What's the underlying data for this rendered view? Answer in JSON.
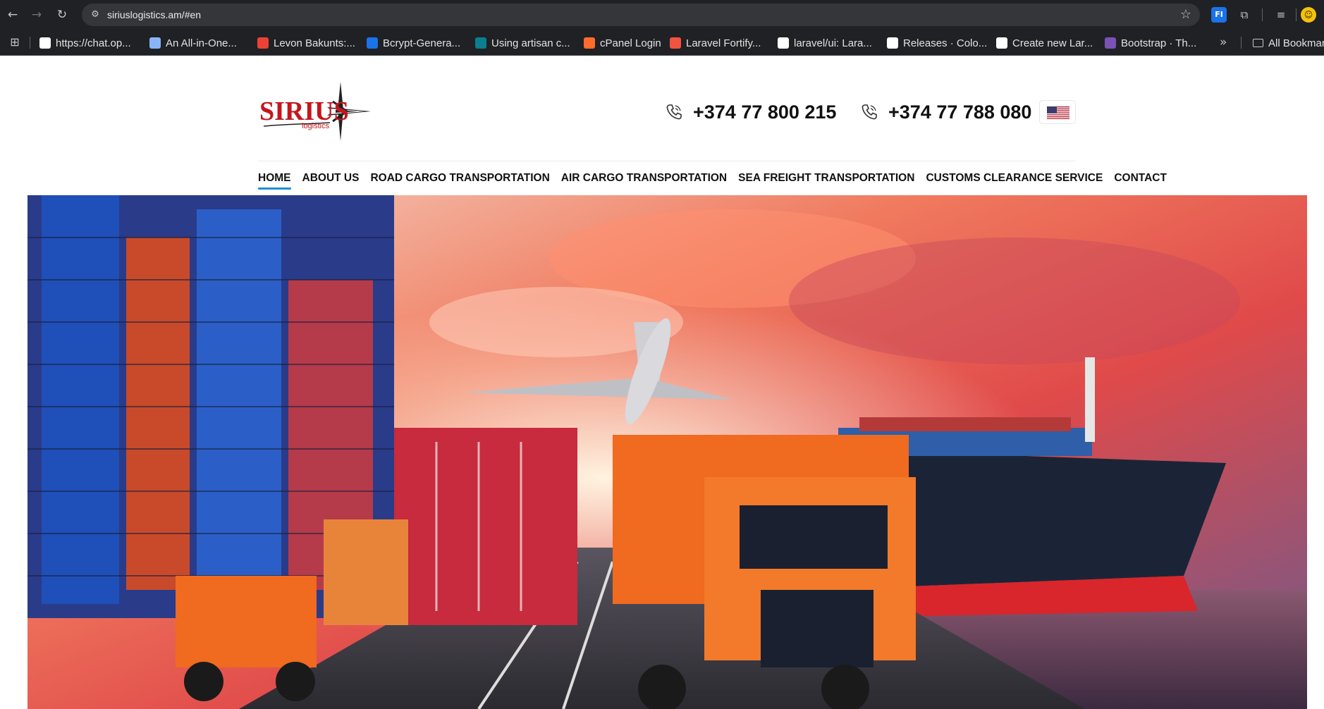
{
  "browser": {
    "url": "siriuslogistics.am/#en",
    "bookmarks": [
      {
        "label": "https://chat.op...",
        "icon": "openai-icon",
        "color": "#ffffff"
      },
      {
        "label": "An All-in-One...",
        "icon": "globe-icon",
        "color": "#8ab4f8"
      },
      {
        "label": "Levon Bakunts:...",
        "icon": "chrome-colorful-icon",
        "color": "#ea4335"
      },
      {
        "label": "Bcrypt-Genera...",
        "icon": "bcrypt-icon",
        "color": "#1a73e8"
      },
      {
        "label": "Using artisan c...",
        "icon": "s-letter-icon",
        "color": "#0a7f8f"
      },
      {
        "label": "cPanel Login",
        "icon": "cpanel-icon",
        "color": "#ff6c2c"
      },
      {
        "label": "Laravel Fortify...",
        "icon": "laravel-icon",
        "color": "#f05340"
      },
      {
        "label": "laravel/ui: Lara...",
        "icon": "github-icon",
        "color": "#ffffff"
      },
      {
        "label": "Releases · Colo...",
        "icon": "github-icon",
        "color": "#ffffff"
      },
      {
        "label": "Create new Lar...",
        "icon": "medium-icon",
        "color": "#ffffff"
      },
      {
        "label": "Bootstrap · Th...",
        "icon": "bootstrap-icon",
        "color": "#7952b3"
      }
    ],
    "all_bookmarks": "All Bookmarks"
  },
  "site": {
    "logo_text": "SIRIUS",
    "logo_sub": "logistics",
    "phones": [
      "+374 77 800 215",
      "+374 77 788 080"
    ],
    "language_flag": "us-flag-icon",
    "nav": [
      {
        "label": "HOME",
        "active": true
      },
      {
        "label": "ABOUT US",
        "active": false
      },
      {
        "label": "ROAD CARGO TRANSPORTATION",
        "active": false
      },
      {
        "label": "AIR CARGO TRANSPORTATION",
        "active": false
      },
      {
        "label": "SEA FREIGHT TRANSPORTATION",
        "active": false
      },
      {
        "label": "CUSTOMS CLEARANCE SERVICE",
        "active": false
      },
      {
        "label": "CONTACT",
        "active": false
      }
    ],
    "hero_image": "logistics-hero-image",
    "colors": {
      "brand_red": "#c4161c",
      "nav_active": "#1f8fd6",
      "text_dark": "#111111"
    }
  }
}
